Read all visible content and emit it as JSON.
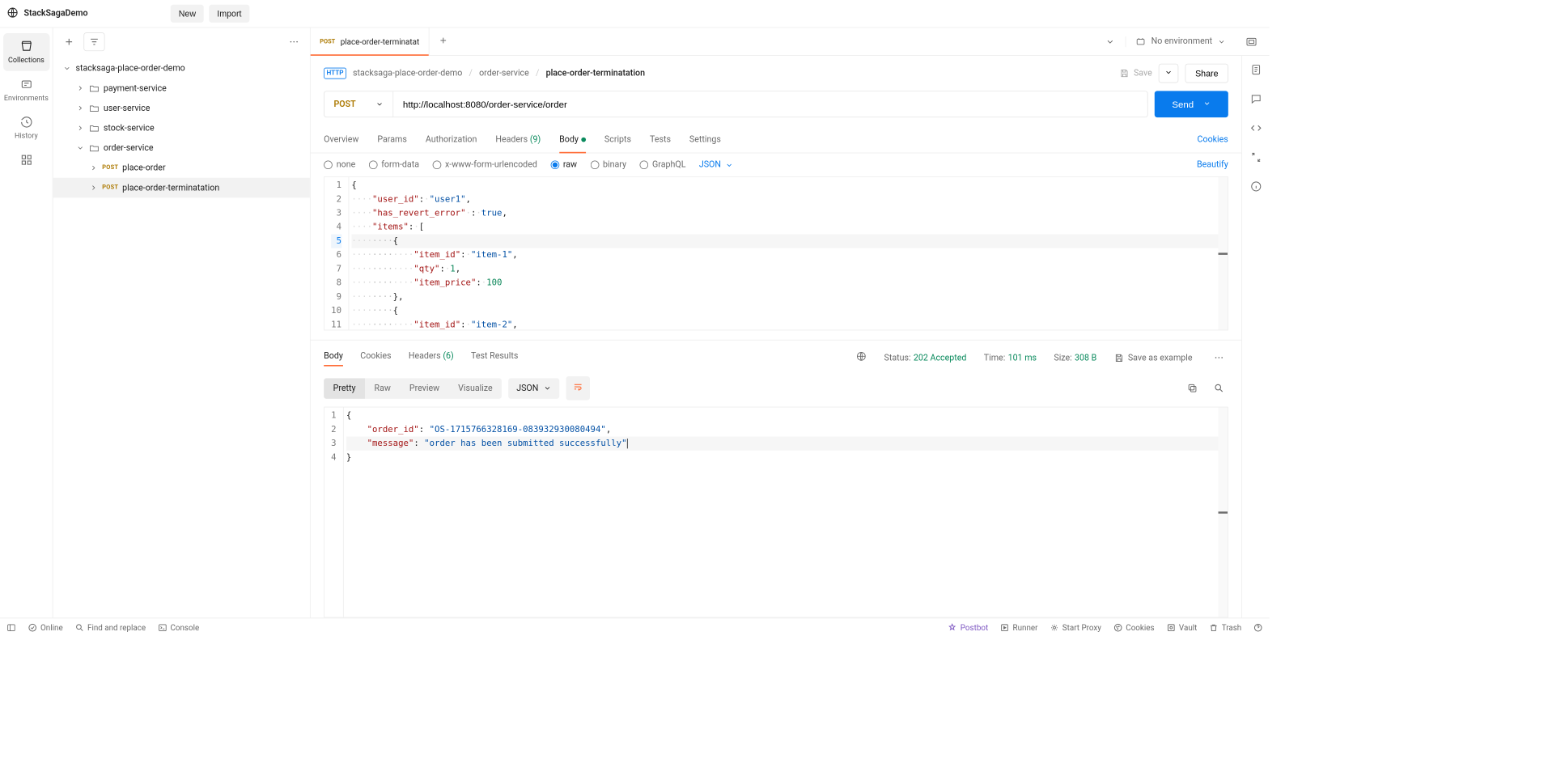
{
  "header": {
    "workspace": "StackSagaDemo",
    "new_btn": "New",
    "import_btn": "Import"
  },
  "nav": {
    "collections": "Collections",
    "environments": "Environments",
    "history": "History"
  },
  "tree": {
    "root": "stacksaga-place-order-demo",
    "payment": "payment-service",
    "user": "user-service",
    "stock": "stock-service",
    "order": "order-service",
    "place_order_method": "POST",
    "place_order": "place-order",
    "terminatation_method": "POST",
    "terminatation": "place-order-terminatation"
  },
  "tab": {
    "method": "POST",
    "title": "place-order-terminatat",
    "no_env": "No environment"
  },
  "crumb": {
    "c1": "stacksaga-place-order-demo",
    "c2": "order-service",
    "c3": "place-order-terminatation",
    "save": "Save",
    "share": "Share"
  },
  "url": {
    "method": "POST",
    "value": "http://localhost:8080/order-service/order",
    "send": "Send"
  },
  "reqtabs": {
    "overview": "Overview",
    "params": "Params",
    "auth": "Authorization",
    "headers": "Headers",
    "headers_count": "(9)",
    "body": "Body",
    "scripts": "Scripts",
    "tests": "Tests",
    "settings": "Settings",
    "cookies": "Cookies"
  },
  "bodyopts": {
    "none": "none",
    "form": "form-data",
    "xwww": "x-www-form-urlencoded",
    "raw": "raw",
    "binary": "binary",
    "graphql": "GraphQL",
    "json": "JSON",
    "beautify": "Beautify"
  },
  "req_body": {
    "l1": "{",
    "l2_key": "\"user_id\"",
    "l2_val": "\"user1\"",
    "l3_key": "\"has_revert_error\"",
    "l3_val": "true",
    "l4_key": "\"items\"",
    "l6_key": "\"item_id\"",
    "l6_val": "\"item-1\"",
    "l7_key": "\"qty\"",
    "l7_val": "1",
    "l8_key": "\"item_price\"",
    "l8_val": "100",
    "l11_key": "\"item_id\"",
    "l11_val": "\"item-2\""
  },
  "resptabs": {
    "body": "Body",
    "cookies": "Cookies",
    "headers": "Headers",
    "headers_count": "(6)",
    "test": "Test Results",
    "status_lbl": "Status:",
    "status_val": "202 Accepted",
    "time_lbl": "Time:",
    "time_val": "101 ms",
    "size_lbl": "Size:",
    "size_val": "308 B",
    "save_example": "Save as example"
  },
  "respfmt": {
    "pretty": "Pretty",
    "raw": "Raw",
    "preview": "Preview",
    "visualize": "Visualize",
    "json": "JSON"
  },
  "resp_body": {
    "l2_key": "\"order_id\"",
    "l2_val": "\"OS-1715766328169-083932930080494\"",
    "l3_key": "\"message\"",
    "l3_val": "\"order has been submitted successfully\""
  },
  "status": {
    "online": "Online",
    "find": "Find and replace",
    "console": "Console",
    "postbot": "Postbot",
    "runner": "Runner",
    "proxy": "Start Proxy",
    "cookies": "Cookies",
    "vault": "Vault",
    "trash": "Trash"
  }
}
